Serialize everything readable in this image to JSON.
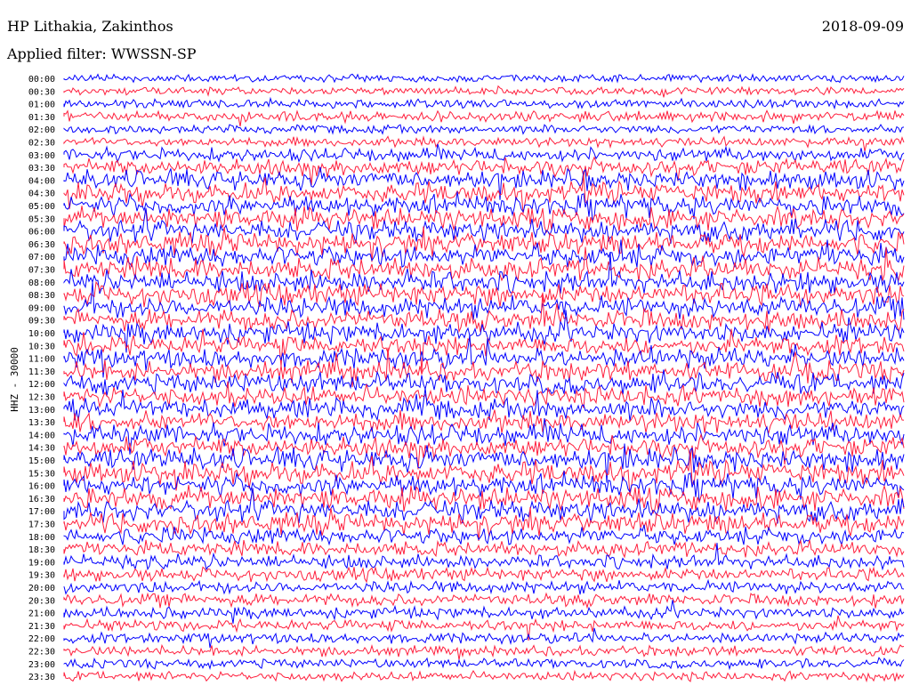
{
  "header": {
    "station": "HP Lithakia, Zakinthos",
    "filter": "Applied filter: WWSSN-SP",
    "date": "2018-09-09"
  },
  "chart_data": {
    "type": "line",
    "title": "HP Lithakia, Zakinthos",
    "subtitle": "Applied filter: WWSSN-SP",
    "date": "2018-09-09",
    "ylabel": "HHZ - 30000",
    "trace_colors": [
      "#0000ff",
      "#ff1f3d"
    ],
    "row_labels": [
      "00:00",
      "00:30",
      "01:00",
      "01:30",
      "02:00",
      "02:30",
      "03:00",
      "03:30",
      "04:00",
      "04:30",
      "05:00",
      "05:30",
      "06:00",
      "06:30",
      "07:00",
      "07:30",
      "08:00",
      "08:30",
      "09:00",
      "09:30",
      "10:00",
      "10:30",
      "11:00",
      "11:30",
      "12:00",
      "12:30",
      "13:00",
      "13:30",
      "14:00",
      "14:30",
      "15:00",
      "15:30",
      "16:00",
      "16:30",
      "17:00",
      "17:30",
      "18:00",
      "18:30",
      "19:00",
      "19:30",
      "20:00",
      "20:30",
      "21:00",
      "21:30",
      "22:00",
      "22:30",
      "23:00",
      "23:30"
    ],
    "row_activity": [
      0.2,
      0.2,
      0.25,
      0.35,
      0.25,
      0.3,
      0.5,
      0.7,
      0.8,
      0.85,
      0.9,
      0.9,
      0.95,
      0.95,
      0.95,
      0.95,
      0.95,
      0.95,
      0.9,
      0.9,
      0.85,
      0.8,
      0.85,
      0.85,
      0.85,
      0.85,
      0.85,
      0.85,
      0.9,
      0.9,
      0.95,
      0.95,
      0.95,
      0.95,
      0.95,
      0.9,
      0.7,
      0.6,
      0.55,
      0.5,
      0.45,
      0.45,
      0.4,
      0.4,
      0.35,
      0.35,
      0.3,
      0.3
    ]
  }
}
